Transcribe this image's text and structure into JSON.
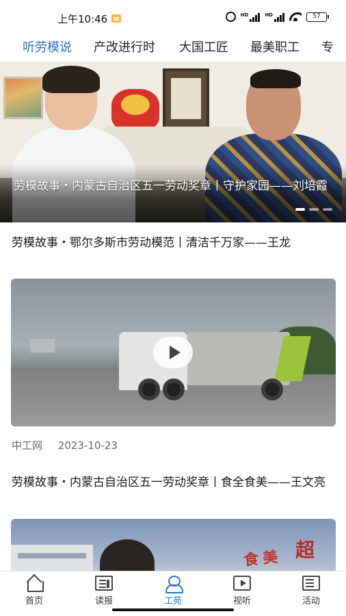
{
  "status_bar": {
    "time": "上午10:46",
    "battery": "57",
    "icons": [
      "message-icon",
      "alarm-icon",
      "hd-signal-icon",
      "hd-signal-icon",
      "wifi-icon",
      "battery-icon"
    ]
  },
  "tabs": [
    {
      "label": "听劳模说",
      "active": true
    },
    {
      "label": "产改进行时",
      "active": false
    },
    {
      "label": "大国工匠",
      "active": false
    },
    {
      "label": "最美职工",
      "active": false
    },
    {
      "label": "专",
      "active": false
    }
  ],
  "banner": {
    "caption": "劳模故事・内蒙古自治区五一劳动奖章丨守护家园——刘培霞",
    "slide_count": 3,
    "active_slide": 1
  },
  "articles": [
    {
      "title": "劳模故事・鄂尔多斯市劳动模范丨清洁千万家——王龙",
      "has_video": true,
      "source": "中工网",
      "date": "2023-10-23"
    },
    {
      "title": "劳模故事・内蒙古自治区五一劳动奖章丨食全食美——王文亮",
      "has_video": false
    }
  ],
  "bottom_nav": [
    {
      "label": "首页",
      "icon": "home-icon",
      "active": false
    },
    {
      "label": "读报",
      "icon": "newspaper-icon",
      "active": false
    },
    {
      "label": "工苑",
      "icon": "worker-icon",
      "active": true
    },
    {
      "label": "视听",
      "icon": "video-icon",
      "active": false
    },
    {
      "label": "活动",
      "icon": "activity-icon",
      "active": false
    }
  ],
  "colors": {
    "accent": "#2a73c4",
    "text": "#1a1a1a",
    "meta": "#666666"
  }
}
